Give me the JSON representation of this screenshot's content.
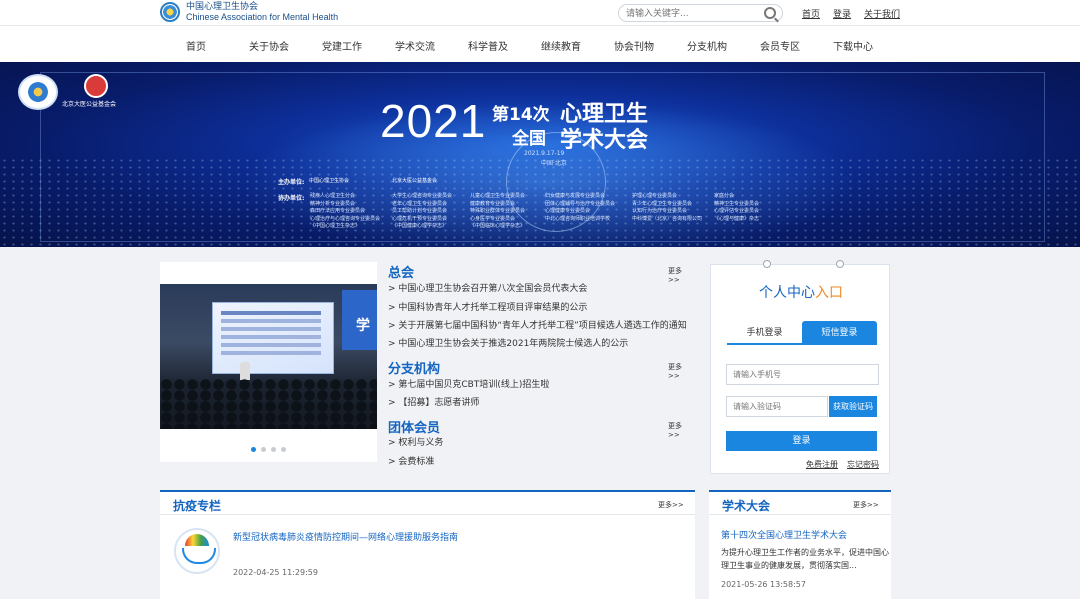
{
  "header": {
    "logo_cn": "中国心理卫生协会",
    "logo_en": "Chinese Association for Mental Health",
    "search_placeholder": "请输入关键字...",
    "links": [
      "首页",
      "登录",
      "关于我们"
    ]
  },
  "nav": {
    "items": [
      "首页",
      "关于协会",
      "党建工作",
      "学术交流",
      "科学普及",
      "继续教育",
      "协会刊物",
      "分支机构",
      "会员专区",
      "下载中心"
    ]
  },
  "banner": {
    "foundation_name": "北京大医公益基金会",
    "year": "2021",
    "line1": "第14次",
    "line2": "全国",
    "big1": "心理卫生",
    "big2": "学术大会",
    "date": "2021.9.17-19",
    "location": "中国·北京",
    "host_label": "主办单位:",
    "host1": "中国心理卫生协会",
    "host2": "北京大医公益基金会",
    "co_label": "协办单位:",
    "co_cols": [
      [
        "残疾人心理卫生分会",
        "精神分析专业委员会",
        "森田疗法应用专业委员会",
        "心理治疗与心理咨询专业委员会",
        "《中国心理卫生杂志》"
      ],
      [
        "大学生心理咨询专业委员会",
        "老年心理卫生专业委员会",
        "员工帮助计划专业委员会",
        "心理危机干预专业委员会",
        "《中国健康心理学杂志》"
      ],
      [
        "儿童心理卫生专业委员会",
        "健康教育专业委员会",
        "特殊职业群体专业委员会",
        "心身医学专业委员会",
        "《中国临床心理学杂志》"
      ],
      [
        "妇女健康与发展专业委员会",
        "团体心理辅导与治疗专业委员会",
        "心理健康专业委员会",
        "中北心理咨询师职业培训学校"
      ],
      [
        "护理心理专业委员会",
        "青少年心理卫生专业委员会",
        "认知行为治疗专业委员会",
        "中科博爱（北京）咨询有限公司"
      ],
      [
        "家庭分会",
        "精神卫生专业委员会",
        "心理评估专业委员会",
        "《心理与健康》杂志"
      ]
    ]
  },
  "slider": {
    "screen_char": "学"
  },
  "news": {
    "more": "更多>>",
    "sections": [
      {
        "title": "总会",
        "items": [
          "> 中国心理卫生协会召开第八次全国会员代表大会",
          "> 中国科协青年人才托举工程项目评审结果的公示",
          "> 关于开展第七届中国科协“青年人才托举工程”项目候选人遴选工作的通知",
          "> 中国心理卫生协会关于推选2021年两院院士候选人的公示"
        ]
      },
      {
        "title": "分支机构",
        "items": [
          "> 第七届中国贝克CBT培训(线上)招生啦",
          "> 【招募】志愿者讲师"
        ]
      },
      {
        "title": "团体会员",
        "items": [
          "> 权利与义务",
          "> 会费标准"
        ]
      }
    ]
  },
  "user_center": {
    "title_main": "个人中心",
    "title_hl": "入口",
    "tab_phone": "手机登录",
    "tab_sms": "短信登录",
    "phone_placeholder": "请输入手机号",
    "code_placeholder": "请输入验证码",
    "code_button": "获取验证码",
    "login_button": "登录",
    "register": "免费注册",
    "forgot": "忘记密码"
  },
  "panels": {
    "anti": {
      "title": "抗疫专栏",
      "more": "更多>>",
      "headline": "新型冠状病毒肺炎疫情防控期间—网络心理援助服务指南",
      "date": "2022-04-25 11:29:59"
    },
    "academic": {
      "title": "学术大会",
      "more": "更多>>",
      "headline": "第十四次全国心理卫生学术大会",
      "desc": "为提升心理卫生工作者的业务水平，促进中国心理卫生事业的健康发展，贯彻落实国...",
      "date": "2021-05-26 13:58:57"
    }
  },
  "colors": {
    "accent": "#1a86e0",
    "title_blue": "#1565c0",
    "highlight": "#f08a24"
  }
}
